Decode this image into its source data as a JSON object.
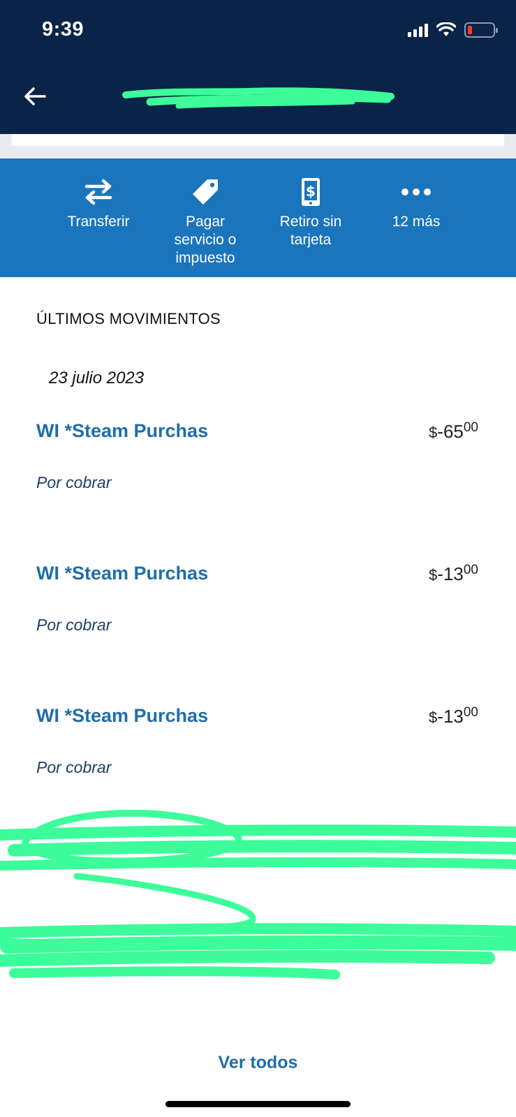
{
  "status_bar": {
    "time": "9:39"
  },
  "colors": {
    "header": "#0a2348",
    "actions_bar": "#1b75bc",
    "link": "#1f6ea8",
    "redaction": "#3dfc9a"
  },
  "actions": [
    {
      "label": "Transferir",
      "icon": "transfer-arrows-icon"
    },
    {
      "label": "Pagar servicio o impuesto",
      "icon": "tag-icon"
    },
    {
      "label": "Retiro sin tarjeta",
      "icon": "phone-dollar-icon"
    },
    {
      "label": "12 más",
      "icon": "more-dots-icon"
    }
  ],
  "movements": {
    "section_title": "ÚLTIMOS MOVIMIENTOS",
    "date": "23 julio 2023",
    "items": [
      {
        "name": "WI *Steam Purchas",
        "status": "Por cobrar",
        "currency": "$",
        "integer": "-65",
        "decimals": "00"
      },
      {
        "name": "WI *Steam Purchas",
        "status": "Por cobrar",
        "currency": "$",
        "integer": "-13",
        "decimals": "00"
      },
      {
        "name": "WI *Steam Purchas",
        "status": "Por cobrar",
        "currency": "$",
        "integer": "-13",
        "decimals": "00"
      }
    ],
    "see_all": "Ver todos"
  }
}
